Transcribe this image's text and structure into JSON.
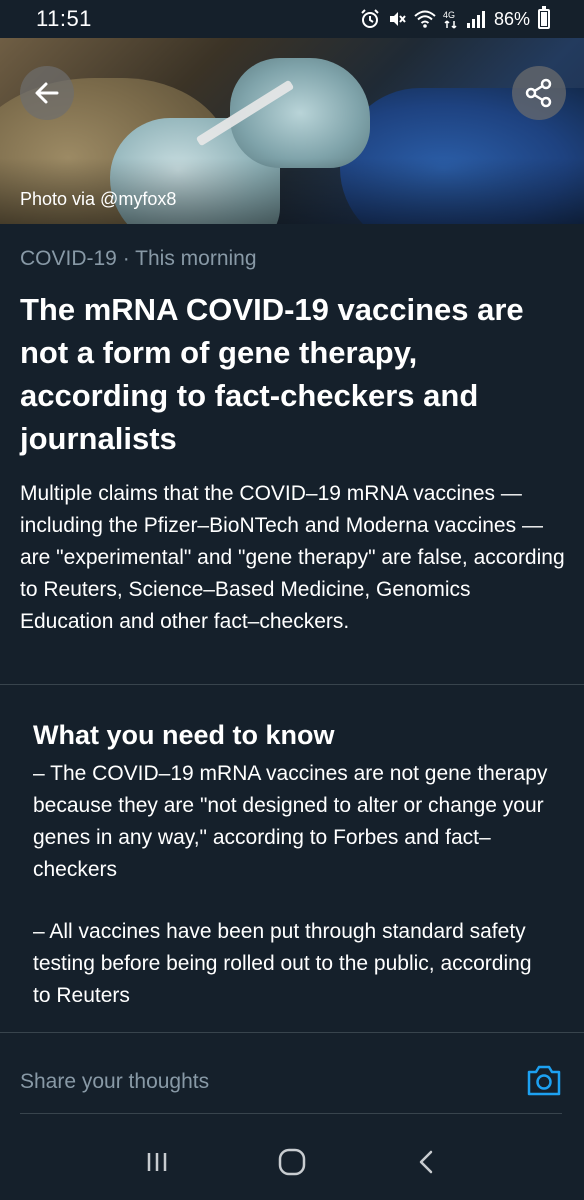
{
  "status_bar": {
    "time": "11:51",
    "battery": "86%",
    "battery_level": 0.86,
    "icons": [
      "alarm-icon",
      "mute-icon",
      "wifi-icon",
      "4g-icon",
      "signal-icon",
      "battery-icon"
    ]
  },
  "hero": {
    "photo_credit": "Photo via @myfox8",
    "back_icon": "arrow-left-icon",
    "share_icon": "share-icon"
  },
  "article": {
    "topic": "COVID-19",
    "separator": " · ",
    "time": "This morning",
    "headline": "The mRNA COVID-19 vaccines are not a form of gene therapy, according to fact-checkers and journalists",
    "summary": "Multiple claims that the COVID–19 mRNA vaccines — including the Pfizer–BioNTech and Moderna vaccines — are \"experimental\" and \"gene therapy\" are false, according to Reuters, Science–Based Medicine, Genomics Education and other fact–checkers."
  },
  "need_to_know": {
    "title": "What you need to know",
    "points": [
      "– The COVID–19 mRNA vaccines are not gene therapy because they are \"not designed to alter or change your genes in any way,\" according to Forbes and fact–checkers",
      "– All vaccines have been put through standard safety testing before being rolled out to the public, according to Reuters"
    ]
  },
  "compose": {
    "placeholder": "Share your thoughts",
    "camera_icon": "camera-icon"
  },
  "nav_bar": {
    "icons": [
      "recents-icon",
      "home-icon",
      "back-icon"
    ]
  },
  "colors": {
    "background": "#15202b",
    "muted_text": "#8899a6",
    "accent": "#1da1f2",
    "divider": "#38444d"
  }
}
